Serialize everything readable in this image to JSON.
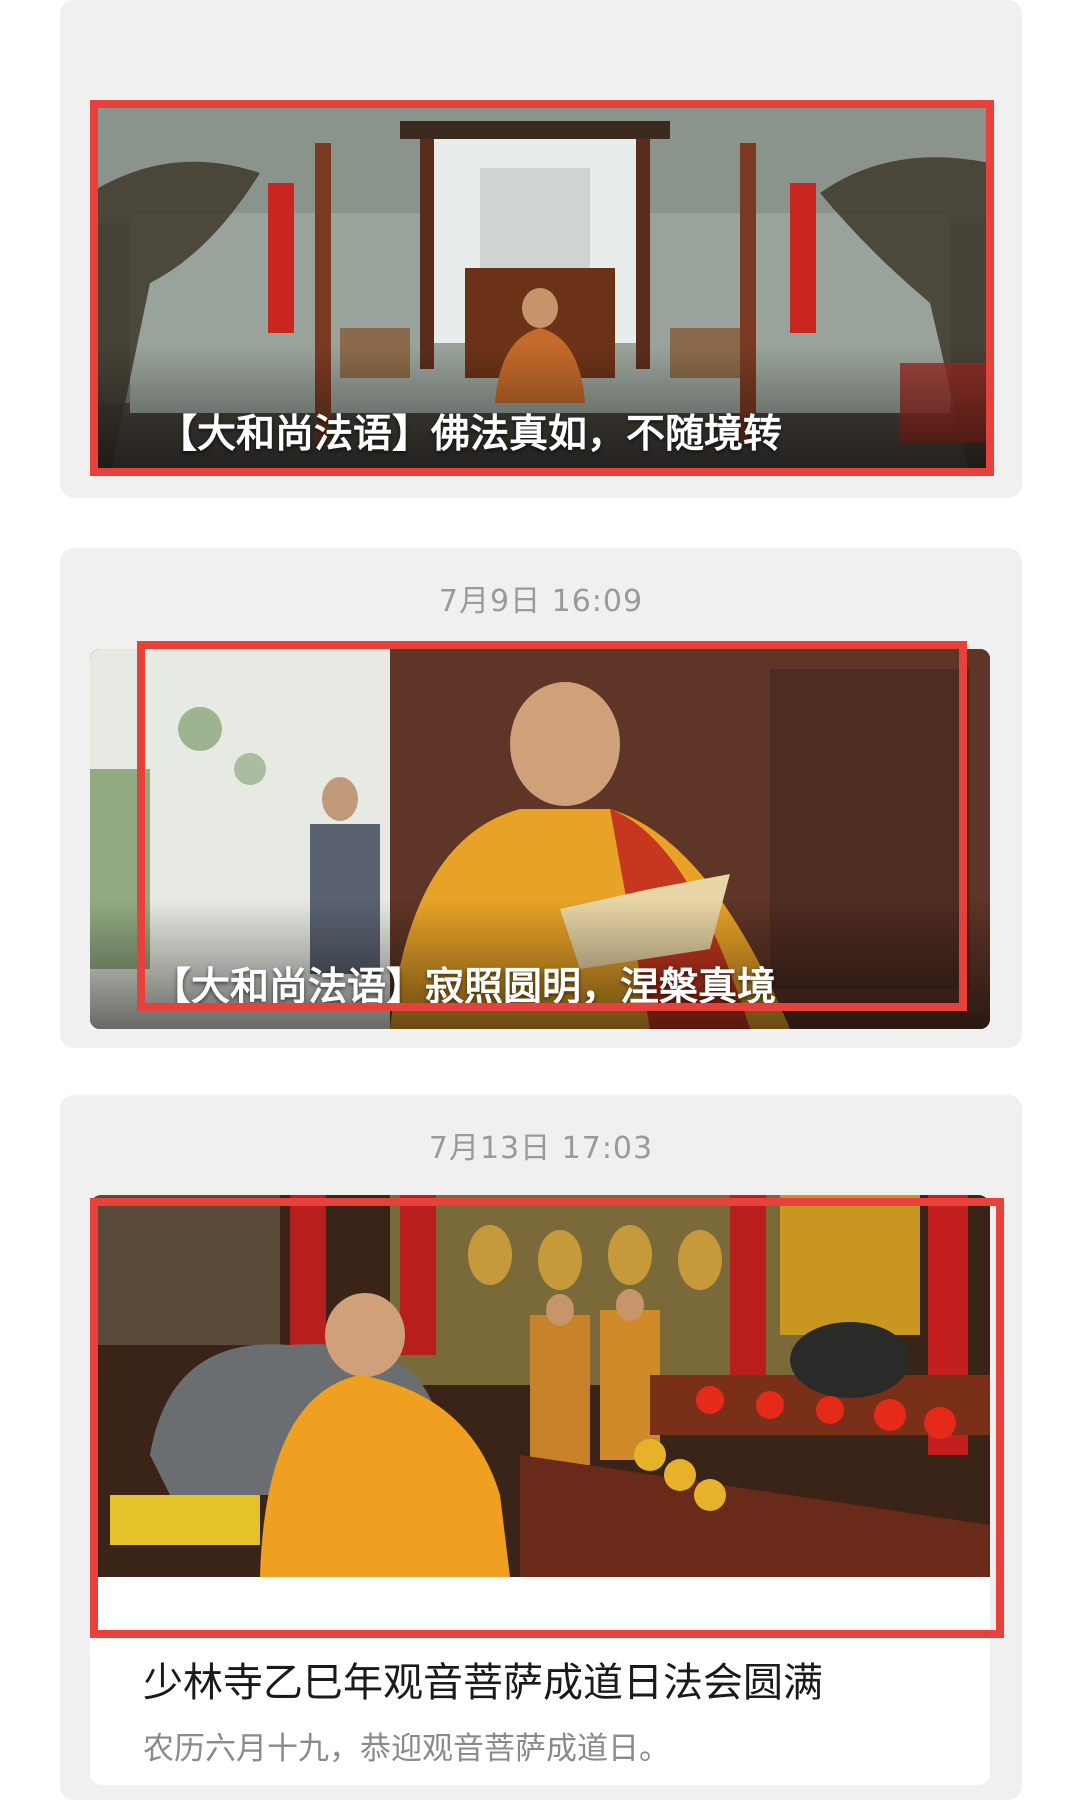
{
  "feed": {
    "item1": {
      "title": "【大和尚法语】佛法真如，不随境转"
    },
    "item2": {
      "time": "7月9日 16:09",
      "title": "【大和尚法语】寂照圆明，涅槃真境"
    },
    "item3": {
      "time": "7月13日 17:03",
      "title": "少林寺乙巳年观音菩萨成道日法会圆满",
      "description": "农历六月十九，恭迎观音菩萨成道日。"
    }
  },
  "colors": {
    "highlight": "#e8403a",
    "group_bg": "#f0f0f0",
    "time_text": "#9a9a9a"
  }
}
